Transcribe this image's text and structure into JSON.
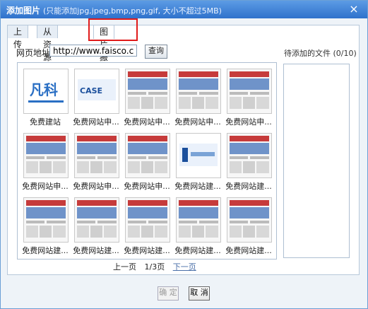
{
  "dialog": {
    "title": "添加图片",
    "hint": "(只能添加jpg,jpeg,bmp,png,gif, 大小不超过5MB)",
    "close": "×"
  },
  "tabs": [
    {
      "label": "上传"
    },
    {
      "label": "从资源库选择"
    },
    {
      "label": "图片搬家"
    }
  ],
  "form": {
    "url_label": "网页地址:",
    "url_value": "http://www.faisco.com",
    "query_label": "查询"
  },
  "pending": {
    "label": "待添加的文件 (0/10)"
  },
  "thumbnails": [
    {
      "caption": "免费建站",
      "icon": "faisco-logo-thumb"
    },
    {
      "caption": "免费网站申...",
      "icon": "case-banner-thumb"
    },
    {
      "caption": "免费网站申...",
      "icon": "site-screenshot-thumb"
    },
    {
      "caption": "免费网站申...",
      "icon": "site-screenshot-thumb"
    },
    {
      "caption": "免费网站申...",
      "icon": "site-screenshot-thumb"
    },
    {
      "caption": "免费网站申...",
      "icon": "site-screenshot-thumb"
    },
    {
      "caption": "免费网站申...",
      "icon": "site-screenshot-thumb"
    },
    {
      "caption": "免费网站申...",
      "icon": "site-screenshot-thumb"
    },
    {
      "caption": "免费网站建...",
      "icon": "latest-work-banner-thumb"
    },
    {
      "caption": "免费网站建...",
      "icon": "site-screenshot-thumb"
    },
    {
      "caption": "免费网站建...",
      "icon": "site-screenshot-thumb"
    },
    {
      "caption": "免费网站建...",
      "icon": "site-screenshot-thumb"
    },
    {
      "caption": "免费网站建...",
      "icon": "site-screenshot-thumb"
    },
    {
      "caption": "免费网站建...",
      "icon": "site-screenshot-thumb"
    },
    {
      "caption": "免费网站建...",
      "icon": "site-screenshot-thumb"
    }
  ],
  "pager": {
    "prev": "上一页",
    "current": "1/3页",
    "next": "下一页"
  },
  "buttons": {
    "ok": "确 定",
    "cancel": "取 消"
  },
  "colors": {
    "titlebar": "#3b7fd4",
    "highlight": "#e01a1a",
    "link": "#4a6fa8"
  }
}
